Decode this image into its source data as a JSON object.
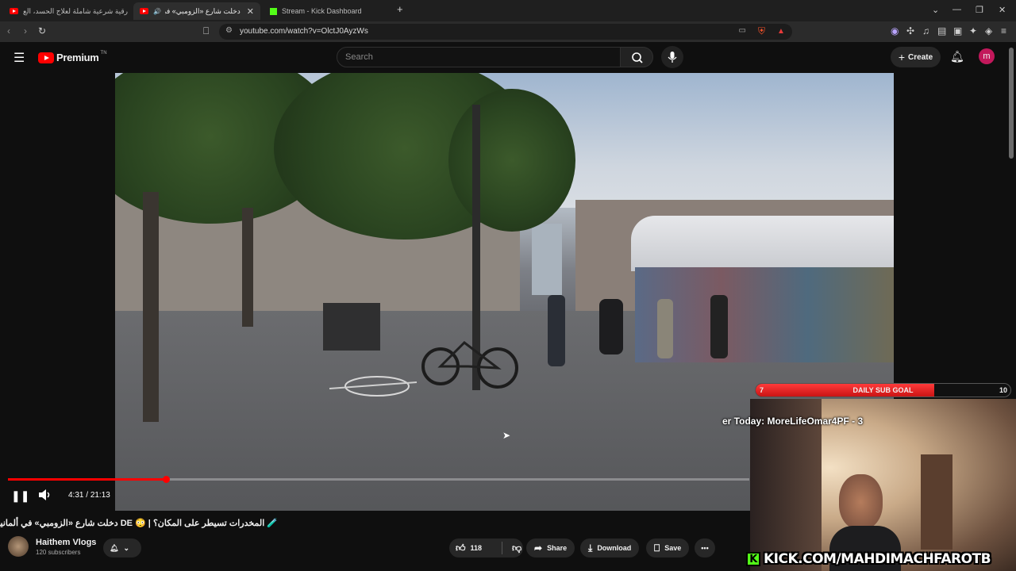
{
  "browser": {
    "tabs": [
      {
        "title": "أقوى رقية شرعية شاملة لعلاج الحسد، الع",
        "favicon": "youtube-icon",
        "active": false
      },
      {
        "title": "دخلت شارع «الزومبي» في ألما",
        "favicon": "youtube-icon",
        "active": true,
        "audio": true
      },
      {
        "title": "Stream - Kick Dashboard",
        "favicon": "kick-icon",
        "active": false
      }
    ],
    "url": "youtube.com/watch?v=OlctJ0AyzWs"
  },
  "youtube": {
    "logo_text": "Premium",
    "logo_sup": "TN",
    "search_placeholder": "Search",
    "create_label": "Create",
    "avatar_letter": "m"
  },
  "player": {
    "time_current": "4:31",
    "time_separator": "/",
    "time_total": "21:13",
    "progress_fraction": 0.213
  },
  "video_info": {
    "title": "🧪 المخدرات تسيطر على المكان؟ | 😳 DE دخلت شارع «الزومبي» في ألمانيا",
    "channel_name": "Haithem Vlogs",
    "subscribers": "120 subscribers",
    "like_count": "118",
    "share_label": "Share",
    "download_label": "Download",
    "save_label": "Save"
  },
  "stream_overlay": {
    "goal_current": "7",
    "goal_label": "DAILY SUB GOAL",
    "goal_target": "10",
    "goal_fraction": 0.7,
    "ticker_text": "er Today: MoreLifeOmar4PF - 3",
    "banner_text": "KICK.COM/MAHDIMACHFAROTB"
  },
  "colors": {
    "accent_red": "#ff0000",
    "kick_green": "#53fc18",
    "bg": "#0f0f0f"
  }
}
